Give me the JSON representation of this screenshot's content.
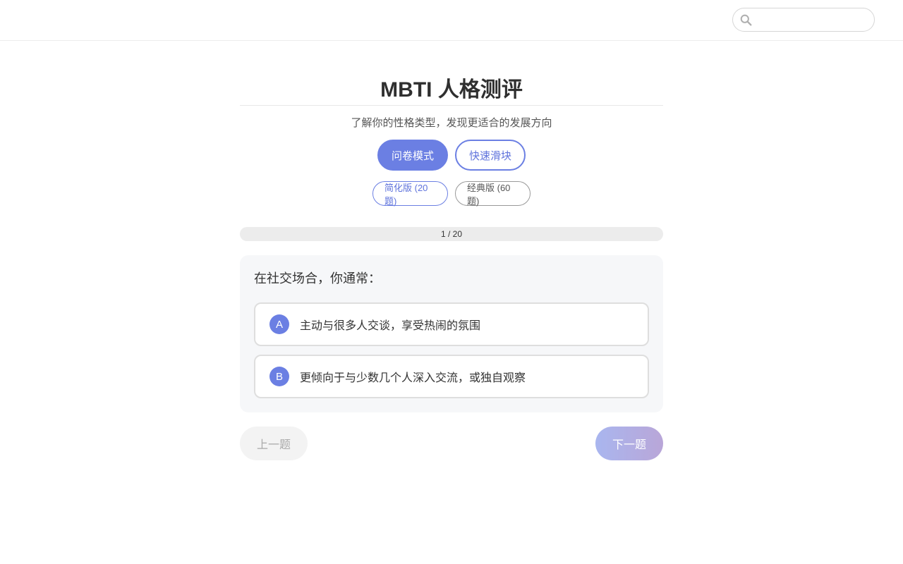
{
  "search": {
    "value": "",
    "placeholder": ""
  },
  "header": {
    "title": "MBTI 人格测评",
    "subtitle": "了解你的性格类型，发现更适合的发展方向"
  },
  "modes": [
    {
      "label": "问卷模式",
      "active": true
    },
    {
      "label": "快速滑块",
      "active": false
    }
  ],
  "versions": [
    {
      "label": "简化版 (20题)",
      "active": true
    },
    {
      "label": "经典版 (60题)",
      "active": false
    }
  ],
  "progress": {
    "text": "1 / 20",
    "current": 1,
    "total": 20,
    "fraction": 0
  },
  "question": {
    "text": "在社交场合，你通常：",
    "options": [
      {
        "letter": "A",
        "text": "主动与很多人交谈，享受热闹的氛围"
      },
      {
        "letter": "B",
        "text": "更倾向于与少数几个人深入交流，或独自观察"
      }
    ]
  },
  "nav": {
    "prev_label": "上一题",
    "next_label": "下一题"
  },
  "colors": {
    "accent": "#6b7fe3",
    "next_gradient_start": "#a9b6ef",
    "next_gradient_end": "#b9a6d8"
  }
}
